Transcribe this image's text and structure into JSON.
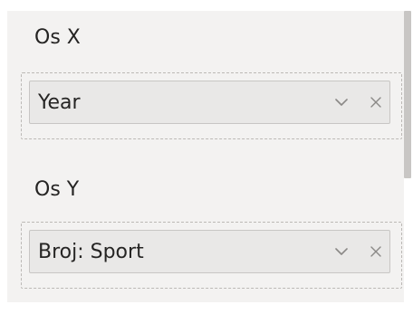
{
  "x_axis": {
    "label": "Os X",
    "field": "Year",
    "expand_icon": "chevron-down-icon",
    "remove_icon": "close-icon"
  },
  "y_axis": {
    "label": "Os Y",
    "field": "Broj: Sport",
    "expand_icon": "chevron-down-icon",
    "remove_icon": "close-icon"
  },
  "colors": {
    "panel_bg": "#f3f2f1",
    "pill_bg": "#e9e8e7",
    "text": "#252423",
    "icon": "#8a8886"
  }
}
